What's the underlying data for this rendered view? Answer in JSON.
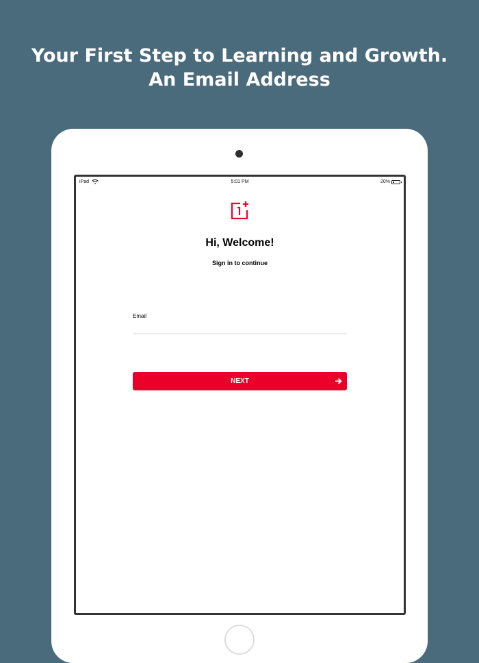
{
  "headline": {
    "line1": "Your First Step to Learning and Growth.",
    "line2": "An Email Address"
  },
  "status_bar": {
    "device": "iPad",
    "time": "5:01 PM",
    "battery": "20%",
    "battery_level": 0.2,
    "icons": [
      "wifi-icon",
      "battery-icon"
    ]
  },
  "app": {
    "logo_icon": "oneplus-logo-icon",
    "brand_color": "#eb0029",
    "welcome_title": "Hi, Welcome!",
    "welcome_subtitle": "Sign in to continue",
    "email_label": "Email",
    "email_value": "",
    "next_label": "NEXT",
    "next_icon": "arrow-right-icon"
  },
  "colors": {
    "background": "#496b7c",
    "device": "#ffffff",
    "screen_border": "#333333",
    "text": "#000000"
  }
}
